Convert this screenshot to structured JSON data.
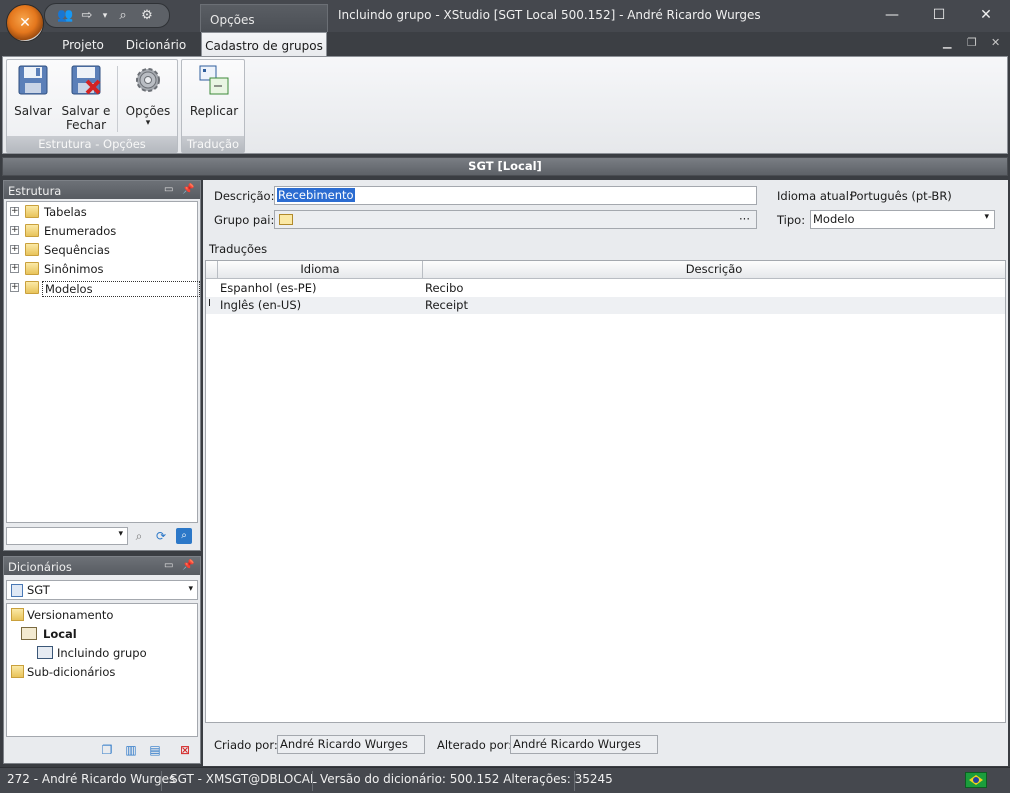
{
  "window": {
    "title": "Incluindo grupo - XStudio [SGT Local 500.152] - André Ricardo Wurges",
    "context_tab_title": "Opções",
    "minimize": "—",
    "maximize": "☐",
    "close": "✕"
  },
  "qat": {
    "icons": [
      "users-icon",
      "export-icon",
      "dropdown-icon",
      "search-icon",
      "gear-icon"
    ]
  },
  "ribbon_tabs": [
    {
      "label": "Projeto"
    },
    {
      "label": "Dicionário"
    },
    {
      "label": "Cadastro de grupos",
      "active": true
    }
  ],
  "ribbon": {
    "groups": [
      {
        "label": "Estrutura - Opções",
        "buttons": [
          "Salvar",
          "Salvar e Fechar",
          "Opções"
        ]
      },
      {
        "label": "Tradução",
        "buttons": [
          "Replicar"
        ]
      }
    ],
    "save_label": "Salvar",
    "save_close_line1": "Salvar e",
    "save_close_line2": "Fechar",
    "options_label": "Opções",
    "options_arrow": "▾",
    "replicate_label": "Replicar",
    "group1_label": "Estrutura - Opções",
    "group2_label": "Tradução"
  },
  "header_strip": "SGT [Local]",
  "estrutura": {
    "title": "Estrutura",
    "items": [
      {
        "label": "Tabelas"
      },
      {
        "label": "Enumerados"
      },
      {
        "label": "Sequências"
      },
      {
        "label": "Sinônimos"
      },
      {
        "label": "Modelos",
        "selected": true
      }
    ]
  },
  "dicionarios": {
    "title": "Dicionários",
    "selected": "SGT",
    "tree": {
      "versionamento": "Versionamento",
      "local": "Local",
      "incluindo": "Incluindo grupo",
      "subdicionarios": "Sub-dicionários"
    }
  },
  "form": {
    "descricao_label": "Descrição:",
    "descricao_value": "Recebimento",
    "grupo_pai_label": "Grupo pai:",
    "grupo_pai_button": "···",
    "idioma_label": "Idioma atual:",
    "idioma_value": "Português (pt-BR)",
    "tipo_label": "Tipo:",
    "tipo_value": "Modelo",
    "traducoes_label": "Traduções",
    "criado_label": "Criado por:",
    "criado_value": "André Ricardo Wurges",
    "alterado_label": "Alterado por:",
    "alterado_value": "André Ricardo Wurges"
  },
  "grid": {
    "columns": [
      "Idioma",
      "Descrição"
    ],
    "rows": [
      {
        "idioma": "Espanhol (es-PE)",
        "descricao": "Recibo"
      },
      {
        "idioma": "Inglês (en-US)",
        "descricao": "Receipt"
      }
    ],
    "row_marker": "I"
  },
  "status": {
    "user": "272 - André Ricardo Wurges",
    "connection": "SGT - XMSGT@DBLOCAL",
    "version": "Versão do dicionário: 500.152 Alterações: 35245"
  },
  "colors": {
    "accent": "#e4771d",
    "selection": "#2b6cd1",
    "chrome": "#45484e"
  }
}
